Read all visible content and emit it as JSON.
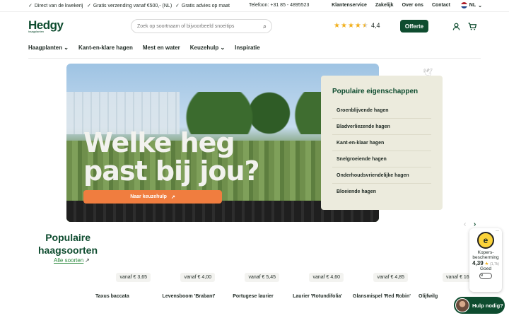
{
  "topbar": {
    "usps": [
      "Direct van de kwekerij",
      "Gratis verzending vanaf €500,- (NL)",
      "Gratis advies op maat"
    ],
    "phone": "Telefoon: +31 85 - 4895523",
    "links": [
      "Klantenservice",
      "Zakelijk",
      "Over ons",
      "Contact"
    ],
    "language": "NL"
  },
  "header": {
    "logo": "Hedgy",
    "logo_sub": "haagplanten",
    "search_placeholder": "Zoek op soortnaam of bijvoorbeeld snoeitips",
    "rating": "4,4",
    "stars": 4.5,
    "cta": "Offerte",
    "accent": "#0e4c2f"
  },
  "nav": [
    "Haagplanten",
    "Kant-en-klare hagen",
    "Mest en water",
    "Keuzehulp",
    "Inspiratie"
  ],
  "hero": {
    "title_line1": "Welke heg",
    "title_line2": "past bij jou?",
    "button": "Naar keuzehulp",
    "button_color": "#f07d3f"
  },
  "properties": {
    "title": "Populaire eigenschappen",
    "items": [
      "Groenblijvende hagen",
      "Bladverliezende hagen",
      "Kant-en-klaar hagen",
      "Snelgroeiende hagen",
      "Onderhoudsvriendelijke hagen",
      "Bloeiende hagen"
    ]
  },
  "popular": {
    "title_line1": "Populaire",
    "title_line2": "haagsoorten",
    "link": "Alle soorten",
    "cards": [
      {
        "price": "vanaf € 3,65",
        "name": "Taxus baccata"
      },
      {
        "price": "vanaf € 4,00",
        "name": "Levensboom 'Brabant'"
      },
      {
        "price": "vanaf € 5,45",
        "name": "Portugese laurier"
      },
      {
        "price": "vanaf € 4,60",
        "name": "Laurier 'Rotundifolia'"
      },
      {
        "price": "vanaf € 4,85",
        "name": "Glansmispel 'Red Robin'"
      },
      {
        "price": "vanaf € 16",
        "name": "Olijfwilg"
      }
    ]
  },
  "trustmark": {
    "label": "Kopers-bescherming",
    "score": "4,39",
    "count": "(1,7k)",
    "verdict": "Goed"
  },
  "help": {
    "label": "Hulp nodig?"
  }
}
